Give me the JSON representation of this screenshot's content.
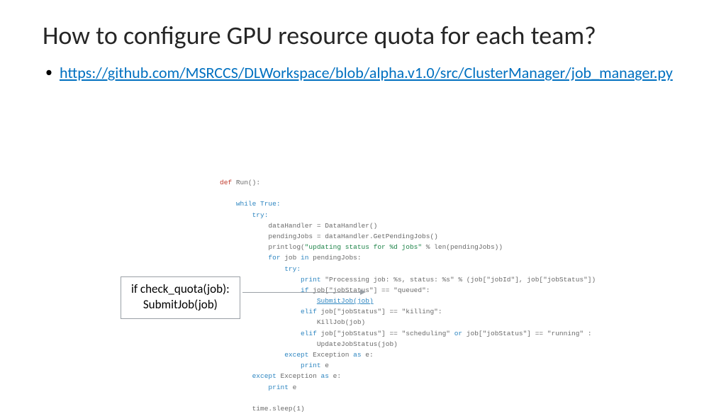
{
  "title": "How to configure GPU resource quota for each team?",
  "link": "https://github.com/MSRCCS/DLWorkspace/blob/alpha.v1.0/src/ClusterManager/job_manager.py",
  "callout": {
    "line1": "if check_quota(job):",
    "line2": "SubmitJob(job)"
  },
  "code": {
    "def": "def",
    "run": "Run():",
    "while": "while",
    "true": "True:",
    "try": "try:",
    "l1": "dataHandler = DataHandler()",
    "l2": "pendingJobs = dataHandler.GetPendingJobs()",
    "l3a": "printlog(",
    "l3b": "\"updating status for %d jobs\"",
    "l3c": " % len(pendingJobs))",
    "for": "for",
    "for_rest": " job ",
    "in": "in",
    "for_tail": " pendingJobs:",
    "print": "print",
    "pr1": " \"Processing job: %s, status: %s\" % (job[\"jobId\"], job[\"jobStatus\"])",
    "if": "if",
    "cond1": " job[\"jobStatus\"] == \"queued\":",
    "submit": "SubmitJob(job)",
    "elif": "elif",
    "cond2": " job[\"jobStatus\"] == \"killing\":",
    "kill": "KillJob(job)",
    "cond3": " job[\"jobStatus\"] == \"scheduling\" ",
    "or": "or",
    "cond3b": " job[\"jobStatus\"] == \"running\" :",
    "update": "UpdateJobStatus(job)",
    "except": "except",
    "exc": " Exception ",
    "as": "as",
    "e": " e:",
    "printe": "print",
    "ee": " e",
    "sleep": "time.sleep(1)"
  }
}
